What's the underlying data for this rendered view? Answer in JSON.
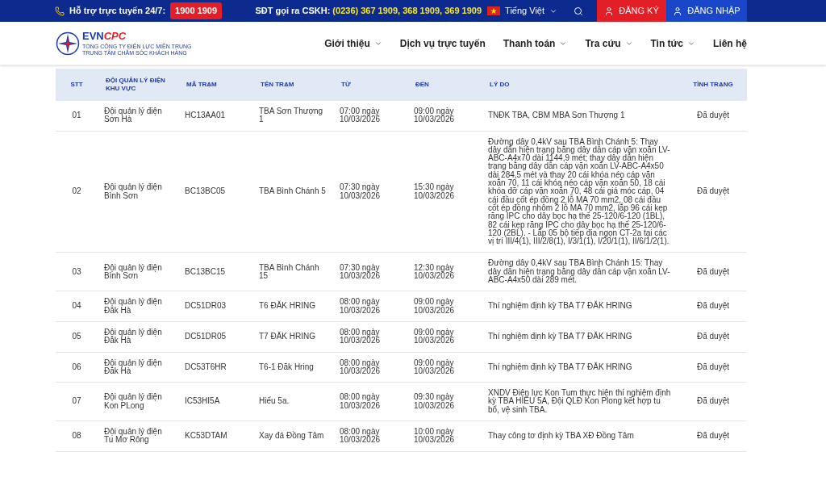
{
  "top_bar": {
    "support_label": "Hỗ trợ trực tuyến 24/7:",
    "hotline": "1900 1909",
    "cskh_label": "SĐT gọi ra CSKH:",
    "cskh_numbers": "(0236) 367 1909, 368 1909, 369 1909",
    "language": "Tiếng Việt",
    "register": "ĐĂNG KÝ",
    "login": "ĐĂNG NHẬP"
  },
  "logo": {
    "brand_evn": "EVN",
    "brand_cpc": "CPC",
    "line1": "TỔNG CÔNG TY ĐIỆN LỰC MIỀN TRUNG",
    "line2": "TRUNG TÂM CHĂM SÓC KHÁCH HÀNG"
  },
  "nav": [
    {
      "label": "Giới thiệu",
      "dropdown": true
    },
    {
      "label": "Dịch vụ trực tuyến",
      "dropdown": false
    },
    {
      "label": "Thanh toán",
      "dropdown": true
    },
    {
      "label": "Tra cứu",
      "dropdown": true
    },
    {
      "label": "Tin tức",
      "dropdown": true
    },
    {
      "label": "Liên hệ",
      "dropdown": false
    }
  ],
  "table": {
    "columns": [
      "STT",
      "ĐỘI QUẢN LÝ ĐIỆN KHU VỰC",
      "MÃ TRẠM",
      "TÊN TRẠM",
      "TỪ",
      "ĐẾN",
      "LÝ DO",
      "TÌNH TRẠNG"
    ],
    "rows": [
      {
        "stt": "01",
        "team": "Đội quản lý điện Sơn Hà",
        "code": "HC13AA01",
        "name": "TBA Sơn Thượng 1",
        "from": "07:00 ngày 10/03/2026",
        "to": "09:00 ngày 10/03/2026",
        "reason": "TNĐK TBA, CBM MBA Sơn Thượng 1",
        "status": "Đã duyệt"
      },
      {
        "stt": "02",
        "team": "Đội quản lý điện Bình Sơn",
        "code": "BC13BC05",
        "name": "TBA Bình Chánh 5",
        "from": "07:30 ngày 10/03/2026",
        "to": "15:30 ngày 10/03/2026",
        "reason": "Đường dây 0,4kV sau TBA Bình Chánh 5: Thay dây dẫn hiện trạng bằng dây dẫn cáp vặn xoắn LV-ABC-A4x70 dài 1144,9 mét; thay dây dẫn hiện trạng bằng dây dẫn cáp vặn xoắn LV-ABC-A4x50 dài 284,5 mét và thay 20 cái khóa néo cáp vặn xoắn 70, 11 cái khóa néo cáp vặn xoắn 50, 18 cái khóa đỡ cáp vặn xoắn 70, 48 cái giá móc cáp, 04 cái đầu cốt ép đồng 2 lỗ MA 70 mm2, 08 cái đầu cốt ép đồng nhôm 2 lỗ MA 70 mm2, lắp 96 cái kẹp răng IPC cho dây bọc hạ thế 25-120/6-120 (1BL), 82 cái kẹp răng IPC cho dây bọc hạ thế 25-120/6-120 (2BL). - Lắp 05 bộ tiếp địa ngọn CT-2a tại các vị trí III/4(1), III/2/8(1), I/3/1(1), I/20/1(1), II/6/1/2(1).",
        "status": "Đã duyệt"
      },
      {
        "stt": "03",
        "team": "Đội quản lý điện Bình Sơn",
        "code": "BC13BC15",
        "name": "TBA Bình Chánh 15",
        "from": "07:30 ngày 10/03/2026",
        "to": "12:30 ngày 10/03/2026",
        "reason": "Đường dây 0,4kV sau TBA Bình Chánh 15: Thay dây dẫn hiện trạng bằng dây dẫn cáp vặn xoắn LV-ABC-A4x50 dài 289 mét.",
        "status": "Đã duyệt"
      },
      {
        "stt": "04",
        "team": "Đội quản lý điện Đăk Hà",
        "code": "DC51DR03",
        "name": "T6 ĐĂK HRING",
        "from": "08:00 ngày 10/03/2026",
        "to": "09:00 ngày 10/03/2026",
        "reason": "Thí nghiệm định kỳ TBA T7 ĐĂK HRING",
        "status": "Đã duyệt"
      },
      {
        "stt": "05",
        "team": "Đội quản lý điện Đăk Hà",
        "code": "DC51DR05",
        "name": "T7 ĐĂK HRING",
        "from": "08:00 ngày 10/03/2026",
        "to": "09:00 ngày 10/03/2026",
        "reason": "Thí nghiệm định kỳ TBA T7 ĐĂK HRING",
        "status": "Đã duyệt"
      },
      {
        "stt": "06",
        "team": "Đội quản lý điện Đăk Hà",
        "code": "DC53T6HR",
        "name": "T6-1 Đăk Hring",
        "from": "08:00 ngày 10/03/2026",
        "to": "09:00 ngày 10/03/2026",
        "reason": "Thí nghiệm định kỳ TBA T7 ĐĂK HRING",
        "status": "Đã duyệt"
      },
      {
        "stt": "07",
        "team": "Đội quản lý điện Kon PLong",
        "code": "IC53HI5A",
        "name": "Hiếu 5a.",
        "from": "08:00 ngày 10/03/2026",
        "to": "09:30 ngày 10/03/2026",
        "reason": "XNDV Điện lực Kon Tum thực hiện thí nghiệm định kỳ TBA HIẾU 5A, Đội QLĐ Kon Plong kết hợp tu bổ, vệ sinh TBA.",
        "status": "Đã duyệt"
      },
      {
        "stt": "08",
        "team": "Đội quản lý điện Tu Mơ Rông",
        "code": "KC53DTAM",
        "name": "Xay đá Đồng Tâm",
        "from": "08:00 ngày 10/03/2026",
        "to": "10:00 ngày 10/03/2026",
        "reason": "Thay công tơ định kỳ TBA XĐ Đồng Tâm",
        "status": "Đã duyệt"
      }
    ]
  }
}
